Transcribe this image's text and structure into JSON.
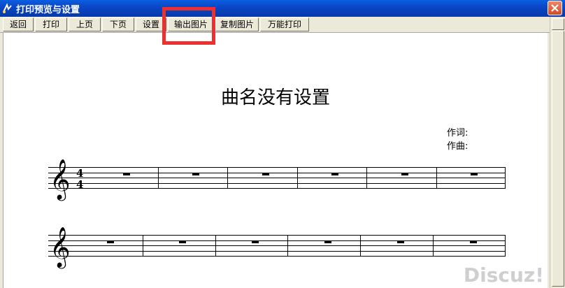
{
  "window": {
    "title": "打印预览与设置"
  },
  "toolbar": {
    "buttons": [
      "返回",
      "打印",
      "上页",
      "下页",
      "设置",
      "输出图片",
      "复制图片",
      "万能打印"
    ]
  },
  "score": {
    "title": "曲名没有设置",
    "lyricist_label": "作词:",
    "composer_label": "作曲:",
    "time_signature": {
      "top": "4",
      "bottom": "4"
    }
  },
  "watermark": "Discuz!",
  "icons": {
    "app": "music-note-icon",
    "close": "close-icon",
    "clef": "treble-clef-icon",
    "rest": "whole-rest-icon"
  }
}
